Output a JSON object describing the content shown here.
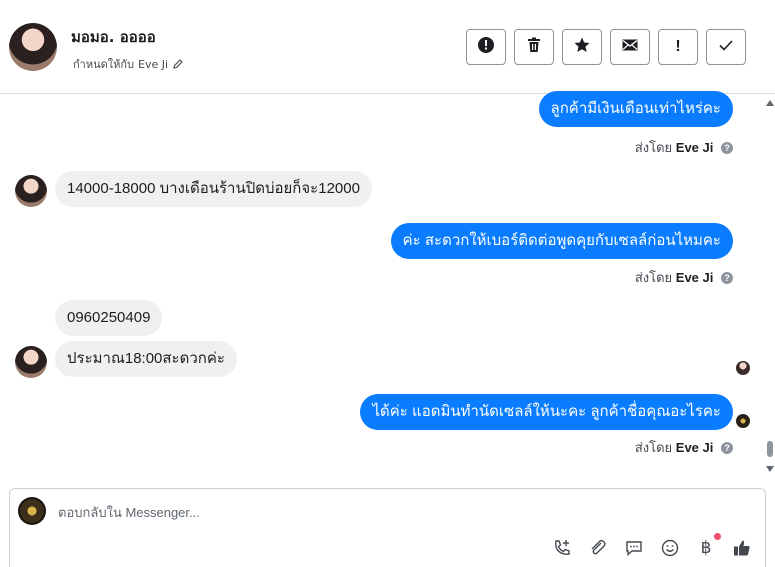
{
  "header": {
    "contact_name": "มอมอ. ออออ",
    "assigned_prefix": "กำหนดให้กับ",
    "assigned_to": "Eve Ji",
    "actions": [
      {
        "name": "report-button",
        "icon": "alert-circle-icon"
      },
      {
        "name": "delete-button",
        "icon": "trash-icon"
      },
      {
        "name": "star-button",
        "icon": "star-icon"
      },
      {
        "name": "mark-unread-button",
        "icon": "envelope-icon"
      },
      {
        "name": "follow-up-button",
        "icon": "exclamation-icon"
      },
      {
        "name": "mark-done-button",
        "icon": "check-icon"
      }
    ]
  },
  "messages": [
    {
      "direction": "out",
      "text": "ลูกค้ามีเงินเดือนเท่าไหร่คะ",
      "sent_by_label": "ส่งโดย",
      "sent_by": "Eve Ji"
    },
    {
      "direction": "in",
      "text": "14000-18000 บางเดือนร้านปิดบ่อยก็จะ12000"
    },
    {
      "direction": "out",
      "text": "ค่ะ สะดวกให้เบอร์ติดต่อพูดคุยกับเซลล์ก่อนไหมคะ",
      "sent_by_label": "ส่งโดย",
      "sent_by": "Eve Ji"
    },
    {
      "direction": "in",
      "text": "0960250409"
    },
    {
      "direction": "in",
      "text": "ประมาณ18:00สะดวกค่ะ"
    },
    {
      "direction": "out",
      "text": "ได้ค่ะ แอดมินทำนัดเซลล์ให้นะคะ ลูกค้าชื่อคุณอะไรคะ",
      "sent_by_label": "ส่งโดย",
      "sent_by": "Eve Ji"
    }
  ],
  "composer": {
    "placeholder": "ตอบกลับใน Messenger...",
    "tools": [
      "phone-plus-icon",
      "paperclip-icon",
      "chat-bubble-icon",
      "smiley-icon",
      "baht-icon",
      "thumbs-up-icon"
    ],
    "baht_symbol": "฿",
    "notification_color": "#f0506e"
  },
  "colors": {
    "outgoing_bubble": "#0a7cff",
    "incoming_bubble": "#f0f0f0"
  }
}
